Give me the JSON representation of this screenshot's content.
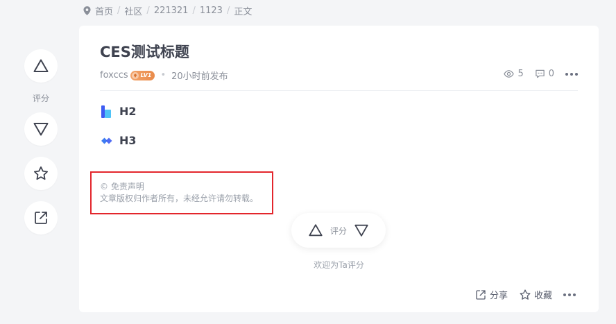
{
  "breadcrumb": {
    "items": [
      "首页",
      "社区",
      "221321",
      "1123",
      "正文"
    ],
    "separator": "/"
  },
  "rail": {
    "rating_label": "评分"
  },
  "post": {
    "title": "CES测试标题",
    "author": "foxccs",
    "level_badge": "LV1",
    "time": "20小时前发布",
    "views": "5",
    "comments": "0",
    "headings": [
      {
        "text": "H2",
        "icon": "h2-icon"
      },
      {
        "text": "H3",
        "icon": "h3-icon"
      }
    ],
    "disclaimer": {
      "title": "© 免责声明",
      "body": "文章版权归作者所有，未经允许请勿转载。"
    },
    "rating": {
      "label": "评分",
      "hint": "欢迎为Ta评分"
    },
    "actions": {
      "share": "分享",
      "favorite": "收藏"
    }
  },
  "colors": {
    "background": "#f4f5f7",
    "card": "#ffffff",
    "highlight_border": "#e3262c",
    "accent_blue": "#3d7cf2",
    "badge": "#e98b4a"
  }
}
